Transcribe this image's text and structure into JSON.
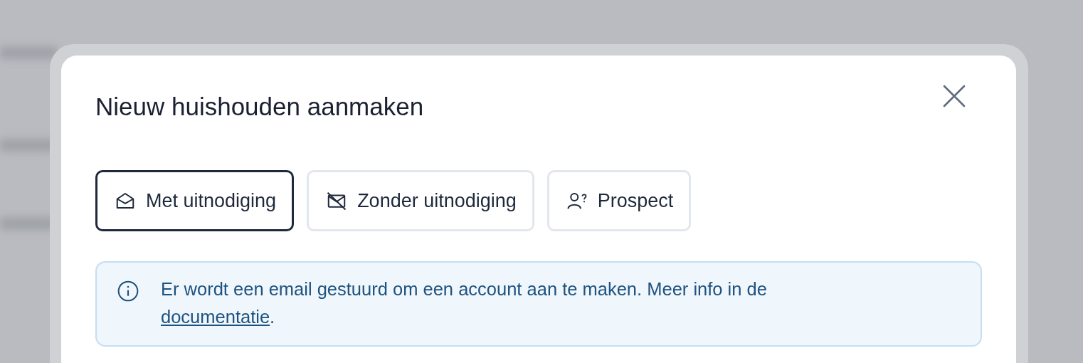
{
  "dialog": {
    "title": "Nieuw huishouden aanmaken"
  },
  "options": [
    {
      "label": "Met uitnodiging",
      "kind": "envelope",
      "selected": true
    },
    {
      "label": "Zonder uitnodiging",
      "kind": "envelope-off",
      "selected": false
    },
    {
      "label": "Prospect",
      "kind": "person-question",
      "selected": false
    }
  ],
  "info": {
    "text": "Er wordt een email gestuurd om een account aan te maken. Meer info in de ",
    "link": "documentatie",
    "suffix": "."
  }
}
